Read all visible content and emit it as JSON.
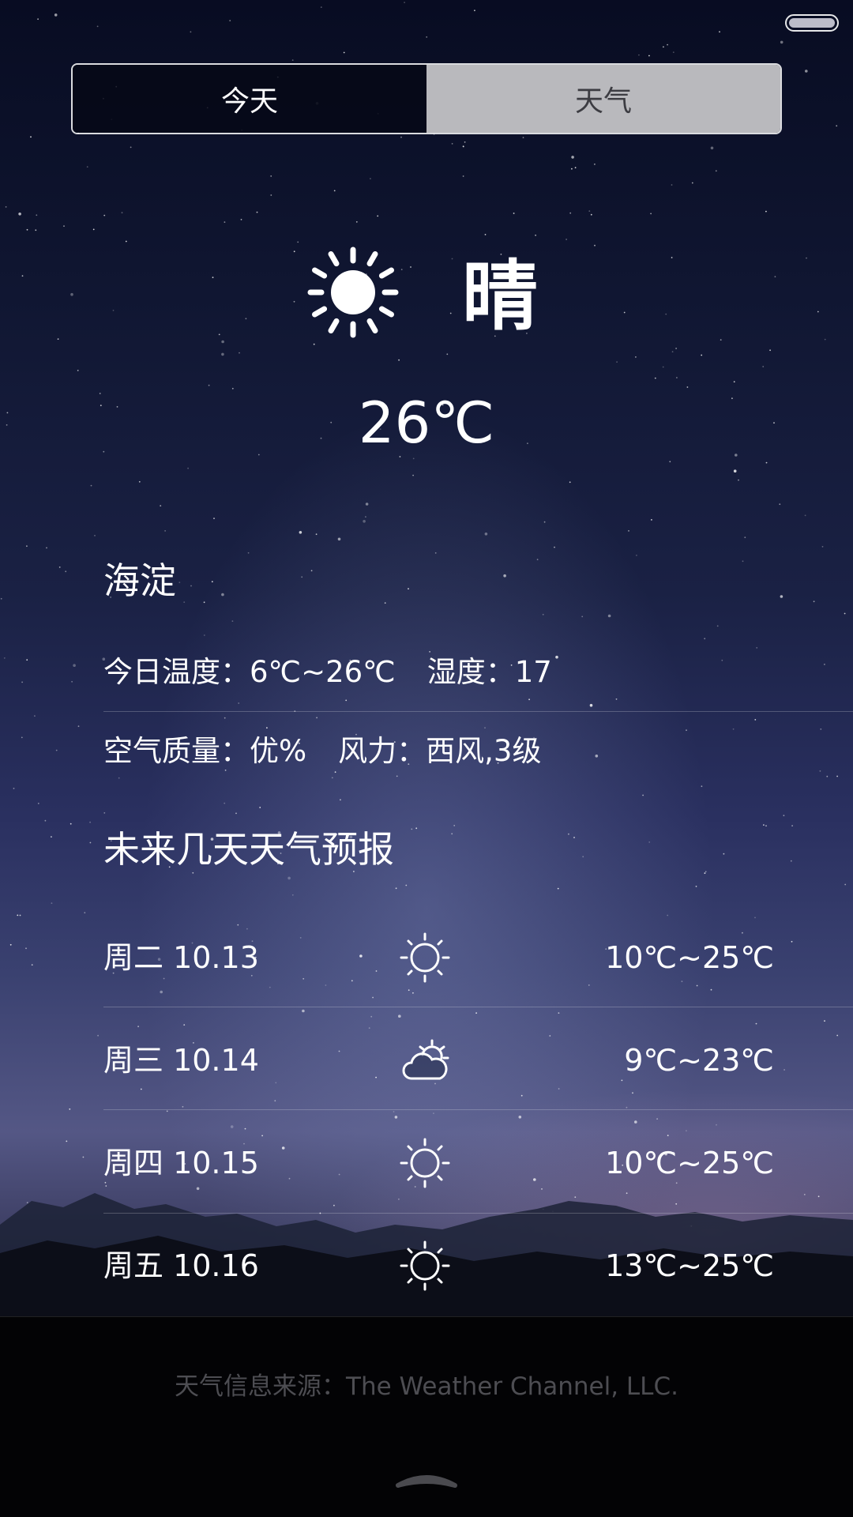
{
  "tabs": {
    "today": "今天",
    "weather": "天气"
  },
  "current": {
    "icon": "sun-icon",
    "condition": "晴",
    "temperature": "26℃"
  },
  "location": "海淀",
  "details": {
    "today_temp_label": "今日温度：",
    "today_temp_value": "6℃~26℃",
    "humidity_label": "湿度：",
    "humidity_value": "17",
    "air_quality_label": "空气质量：",
    "air_quality_value": "优%",
    "wind_label": "风力：",
    "wind_value": "西风,3级"
  },
  "forecast": {
    "title": "未来几天天气预报",
    "days": [
      {
        "date": "周二 10.13",
        "icon": "sun-outline-icon",
        "range": "10℃~25℃"
      },
      {
        "date": "周三 10.14",
        "icon": "partly-cloudy-icon",
        "range": "9℃~23℃"
      },
      {
        "date": "周四 10.15",
        "icon": "sun-outline-icon",
        "range": "10℃~25℃"
      },
      {
        "date": "周五 10.16",
        "icon": "sun-outline-icon",
        "range": "13℃~25℃"
      }
    ]
  },
  "footer": {
    "source": "天气信息来源：The Weather Channel, LLC."
  },
  "colors": {
    "tab_active_bg": "#b9b9bd",
    "source_text": "#4d4d52"
  }
}
